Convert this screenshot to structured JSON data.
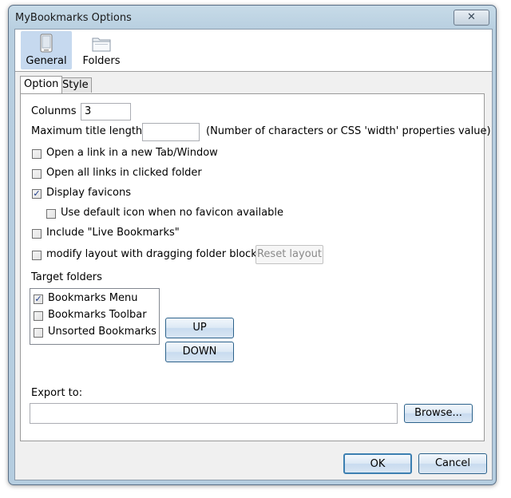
{
  "window": {
    "title": "MyBookmarks Options",
    "close_glyph": "✕"
  },
  "toolbar": {
    "items": [
      {
        "label": "General",
        "icon": "general-icon",
        "selected": true
      },
      {
        "label": "Folders",
        "icon": "folders-icon",
        "selected": false
      }
    ]
  },
  "tabs": [
    {
      "label": "Option",
      "selected": true
    },
    {
      "label": "Style",
      "selected": false
    }
  ],
  "options": {
    "columns_label": "Colunms",
    "columns_value": "3",
    "max_title_label": "Maximum title length",
    "max_title_value": "",
    "max_title_hint": "(Number of characters or CSS 'width' properties value)",
    "open_new_tab": {
      "label": "Open a link in a new Tab/Window",
      "checked": false
    },
    "open_all_links": {
      "label": "Open all links in clicked folder",
      "checked": false
    },
    "display_favicons": {
      "label": "Display favicons",
      "checked": true
    },
    "use_default_icon": {
      "label": "Use default icon when no favicon available",
      "checked": false
    },
    "include_live": {
      "label": "Include \"Live Bookmarks\"",
      "checked": false
    },
    "modify_layout": {
      "label": "modify layout with dragging folder block",
      "checked": false
    },
    "reset_layout_label": "Reset layout"
  },
  "target_folders": {
    "label": "Target folders",
    "items": [
      {
        "label": "Bookmarks Menu",
        "checked": true
      },
      {
        "label": "Bookmarks Toolbar",
        "checked": false
      },
      {
        "label": "Unsorted Bookmarks",
        "checked": false
      }
    ],
    "up_label": "UP",
    "down_label": "DOWN"
  },
  "export": {
    "label": "Export to:",
    "value": "",
    "browse_label": "Browse..."
  },
  "footer": {
    "ok_label": "OK",
    "cancel_label": "Cancel"
  },
  "check_glyph": "✓"
}
